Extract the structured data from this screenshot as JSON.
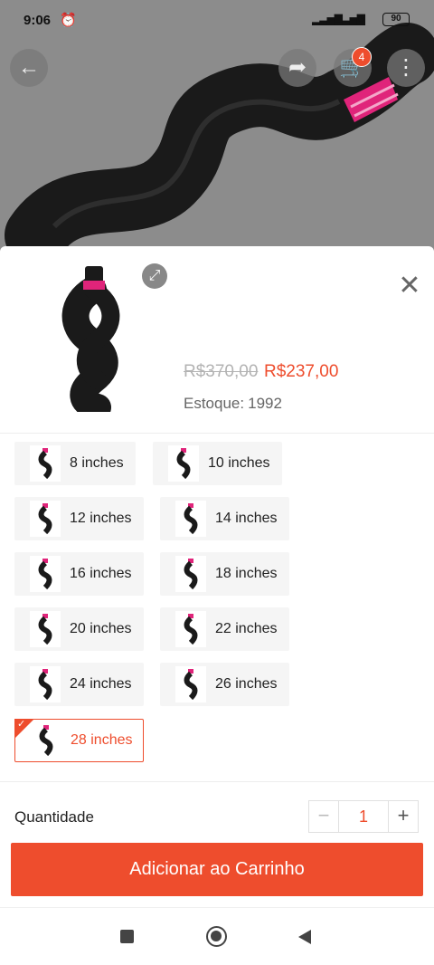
{
  "status_bar": {
    "time": "9:06",
    "battery": "90"
  },
  "header": {
    "cart_count": "4"
  },
  "product": {
    "old_price": "R$370,00",
    "price": "R$237,00",
    "stock_label": "Estoque:",
    "stock_value": "1992"
  },
  "options": [
    {
      "label": "8 inches",
      "selected": false
    },
    {
      "label": "10 inches",
      "selected": false
    },
    {
      "label": "12 inches",
      "selected": false
    },
    {
      "label": "14 inches",
      "selected": false
    },
    {
      "label": "16 inches",
      "selected": false
    },
    {
      "label": "18 inches",
      "selected": false
    },
    {
      "label": "20 inches",
      "selected": false
    },
    {
      "label": "22 inches",
      "selected": false
    },
    {
      "label": "24 inches",
      "selected": false
    },
    {
      "label": "26 inches",
      "selected": false
    },
    {
      "label": "28 inches",
      "selected": true
    }
  ],
  "quantity": {
    "label": "Quantidade",
    "value": "1",
    "minus": "−",
    "plus": "+"
  },
  "add_to_cart": "Adicionar ao Carrinho",
  "colors": {
    "accent": "#ee4d2d",
    "hair_wrap": "#e0247a"
  }
}
